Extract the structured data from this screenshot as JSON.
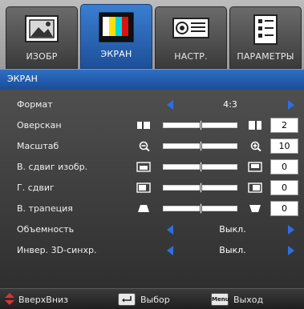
{
  "tabs": [
    {
      "label": "ИЗОБР",
      "icon": "picture-icon"
    },
    {
      "label": "ЭКРАН",
      "icon": "display-icon"
    },
    {
      "label": "НАСТР.",
      "icon": "projector-icon"
    },
    {
      "label": "ПАРАМЕТРЫ",
      "icon": "options-icon"
    }
  ],
  "header": {
    "title": "ЭКРАН"
  },
  "menu": [
    {
      "label": "Формат",
      "value": "4:3"
    },
    {
      "label": "Оверскан",
      "value": "2",
      "level": 0.52
    },
    {
      "label": "Масштаб",
      "value": "10",
      "level": 0.52
    },
    {
      "label": "В. сдвиг изобр.",
      "value": "0",
      "level": 0.52
    },
    {
      "label": "Г. сдвиг",
      "value": "0",
      "level": 0.52
    },
    {
      "label": "В. трапеция",
      "value": "0",
      "level": 0.52
    },
    {
      "label": "Объемность",
      "value": "Выкл."
    },
    {
      "label": "Инвер. 3D-синхр.",
      "value": "Выкл."
    }
  ],
  "footer": {
    "nav_label": "ВверхВниз",
    "select_label": "Выбор",
    "menu_key": "Menu",
    "exit_label": "Выход"
  },
  "colors": {
    "accent": "#2e6fe0",
    "header": "#1f56a6"
  }
}
